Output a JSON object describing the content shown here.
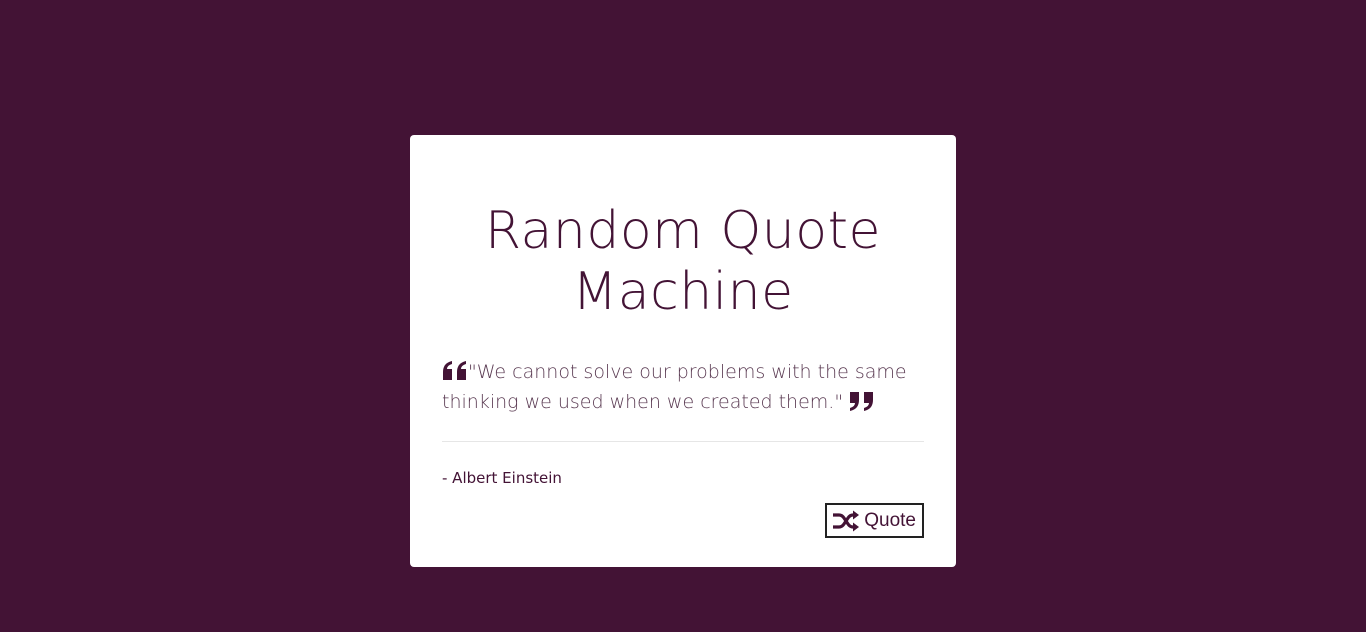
{
  "app": {
    "title": "Random Quote Machine"
  },
  "quote": {
    "text": "\"We cannot solve our problems with the same thinking we used when we created them.\"",
    "author": "- Albert Einstein"
  },
  "actions": {
    "new_quote_label": "Quote",
    "new_quote_icon": "shuffle-icon"
  },
  "icons": {
    "open_quote": "quote-left-icon",
    "close_quote": "quote-right-icon"
  },
  "colors": {
    "background": "#431335",
    "card": "#ffffff",
    "accent": "#431335"
  }
}
